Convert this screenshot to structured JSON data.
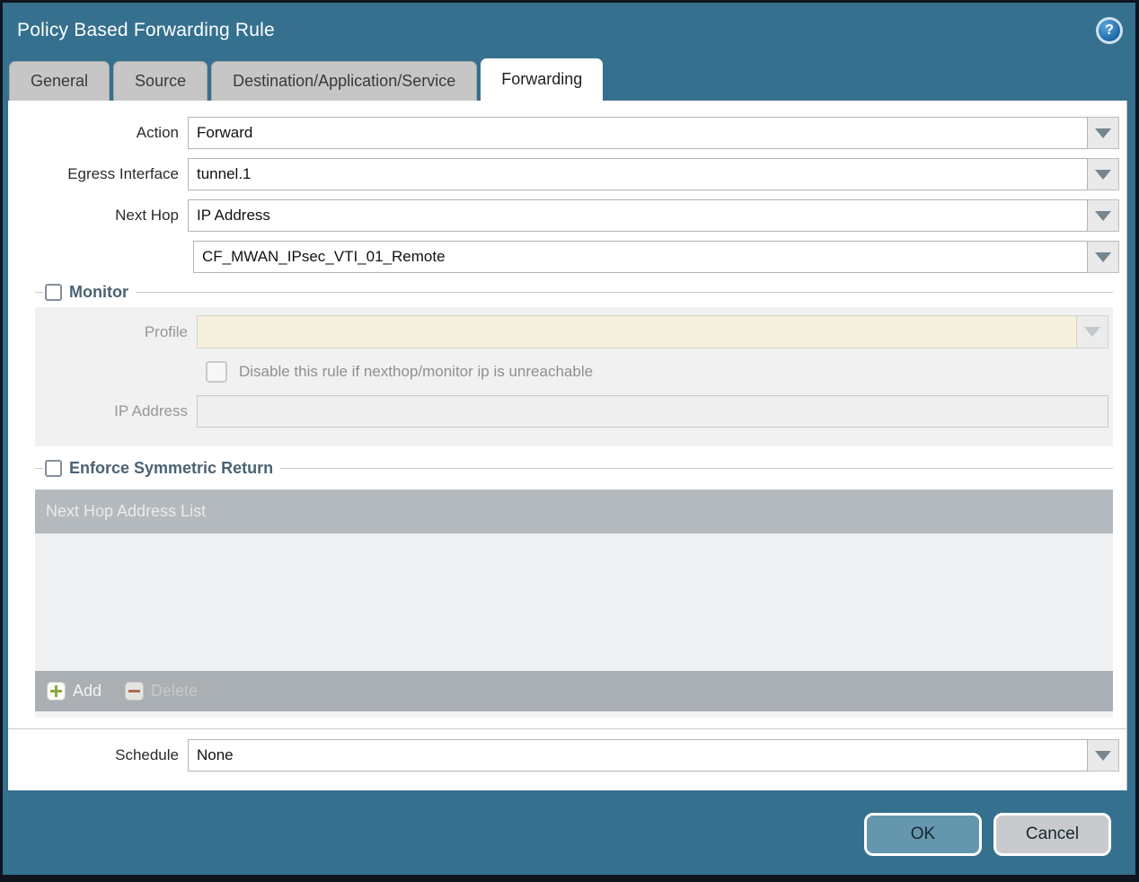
{
  "dialog": {
    "title": "Policy Based Forwarding Rule",
    "help_glyph": "?"
  },
  "tabs": [
    {
      "label": "General",
      "active": false
    },
    {
      "label": "Source",
      "active": false
    },
    {
      "label": "Destination/Application/Service",
      "active": false
    },
    {
      "label": "Forwarding",
      "active": true
    }
  ],
  "form": {
    "action": {
      "label": "Action",
      "value": "Forward"
    },
    "egress_interface": {
      "label": "Egress Interface",
      "value": "tunnel.1"
    },
    "next_hop": {
      "label": "Next Hop",
      "value": "IP Address"
    },
    "next_hop_address": {
      "value": "CF_MWAN_IPsec_VTI_01_Remote"
    },
    "schedule": {
      "label": "Schedule",
      "value": "None"
    }
  },
  "monitor": {
    "title": "Monitor",
    "checked": false,
    "profile": {
      "label": "Profile",
      "value": ""
    },
    "disable_rule": {
      "label": "Disable this rule if nexthop/monitor ip is unreachable",
      "checked": false
    },
    "ip_address": {
      "label": "IP Address",
      "value": ""
    }
  },
  "enforce_symmetric_return": {
    "title": "Enforce Symmetric Return",
    "checked": false,
    "table": {
      "header": "Next Hop Address List",
      "rows": [],
      "add_label": "Add",
      "delete_label": "Delete"
    }
  },
  "footer": {
    "ok_label": "OK",
    "cancel_label": "Cancel"
  },
  "colors": {
    "titlebar_teal": "#35708E",
    "active_tab_bg": "#FFFFFF",
    "inactive_tab_bg": "#C6C6C6",
    "section_title": "#4A6374",
    "disabled_field_beige": "#F5F0DD",
    "table_header_gray": "#B4B9BD",
    "ok_button": "#6496AE",
    "cancel_button": "#C9CACD"
  }
}
